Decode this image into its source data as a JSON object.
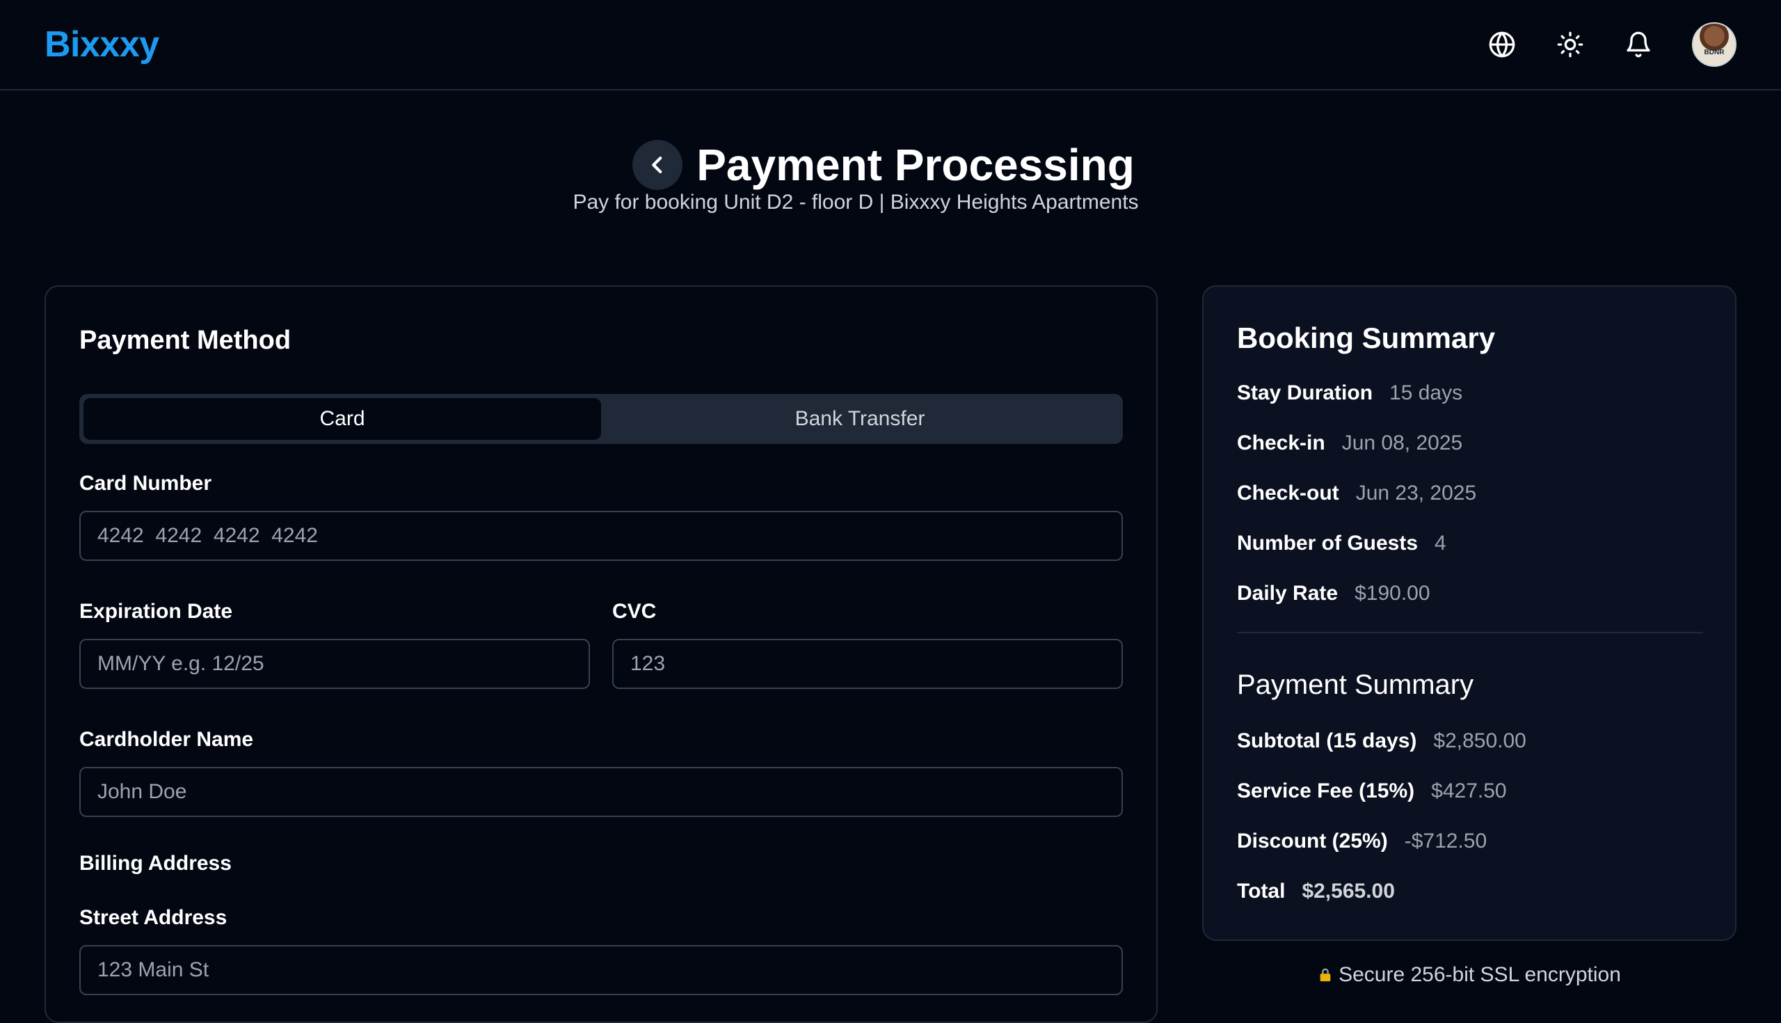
{
  "header": {
    "logo": "Bixxxy",
    "icons": [
      "globe-icon",
      "sun-icon",
      "bell-icon"
    ],
    "avatar_text": "BDNR"
  },
  "page": {
    "title": "Payment Processing",
    "subtitle": "Pay for booking Unit D2 - floor D | Bixxxy Heights Apartments"
  },
  "payment_method": {
    "title": "Payment Method",
    "tabs": [
      {
        "label": "Card",
        "active": true
      },
      {
        "label": "Bank Transfer",
        "active": false
      }
    ],
    "fields": {
      "card_number": {
        "label": "Card Number",
        "placeholder": "4242  4242  4242  4242"
      },
      "expiration": {
        "label": "Expiration Date",
        "placeholder": "MM/YY e.g. 12/25"
      },
      "cvc": {
        "label": "CVC",
        "placeholder": "123"
      },
      "cardholder": {
        "label": "Cardholder Name",
        "placeholder": "John Doe"
      },
      "billing_heading": "Billing Address",
      "street": {
        "label": "Street Address",
        "placeholder": "123 Main St"
      }
    }
  },
  "booking_summary": {
    "title": "Booking Summary",
    "rows": [
      {
        "label": "Stay Duration",
        "value": "15 days"
      },
      {
        "label": "Check-in",
        "value": "Jun 08, 2025"
      },
      {
        "label": "Check-out",
        "value": "Jun 23, 2025"
      },
      {
        "label": "Number of Guests",
        "value": "4"
      },
      {
        "label": "Daily Rate",
        "value": "$190.00"
      }
    ]
  },
  "payment_summary": {
    "title": "Payment Summary",
    "rows": [
      {
        "label": "Subtotal (15 days)",
        "value": "$2,850.00"
      },
      {
        "label": "Service Fee (15%)",
        "value": "$427.50"
      },
      {
        "label": "Discount (25%)",
        "value": "-$712.50"
      },
      {
        "label": "Total",
        "value": "$2,565.00"
      }
    ]
  },
  "secure_note": "Secure 256-bit SSL encryption",
  "colors": {
    "background": "#030712",
    "brand": "#1d9bf0",
    "border": "#1f2937",
    "muted_text": "#9ca3af"
  }
}
